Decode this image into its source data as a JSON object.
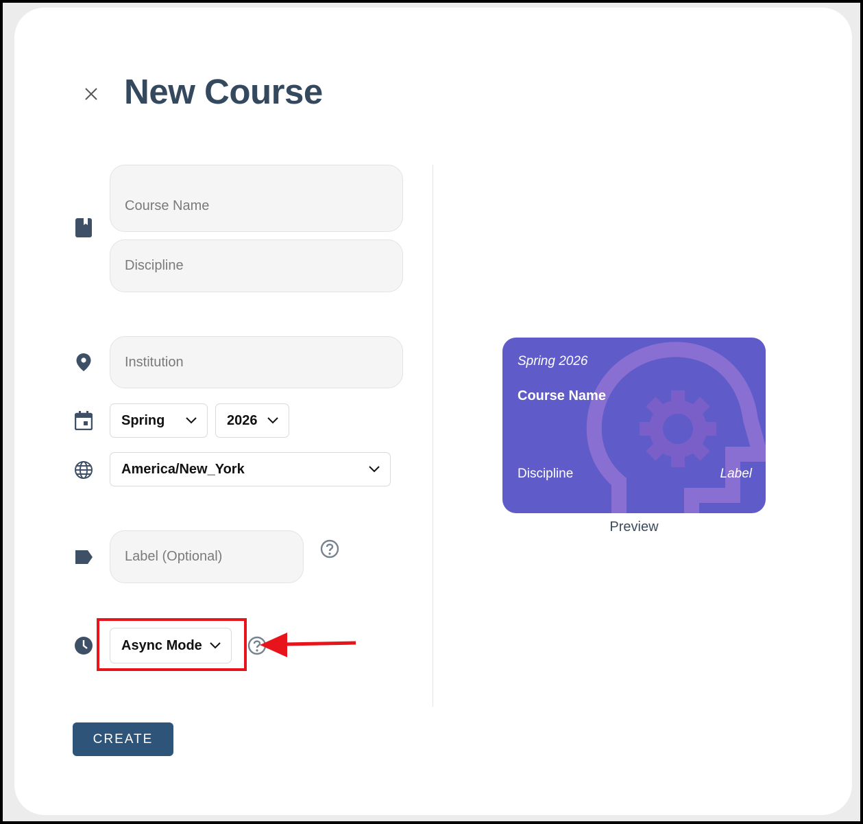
{
  "dialog": {
    "title": "New Course",
    "create_label": "CREATE"
  },
  "form": {
    "course_name_placeholder": "Course Name",
    "discipline_placeholder": "Discipline",
    "institution_placeholder": "Institution",
    "term_select": "Spring",
    "year_select": "2026",
    "timezone_select": "America/New_York",
    "label_placeholder": "Label (Optional)",
    "mode_select": "Async Mode"
  },
  "preview": {
    "term": "Spring 2026",
    "course_name": "Course Name",
    "discipline": "Discipline",
    "label": "Label",
    "caption": "Preview",
    "card_color": "#5f5bc9"
  },
  "colors": {
    "title": "#34495e",
    "icon": "#3d5066",
    "button": "#2e5479",
    "annotation": "#e8141c"
  }
}
